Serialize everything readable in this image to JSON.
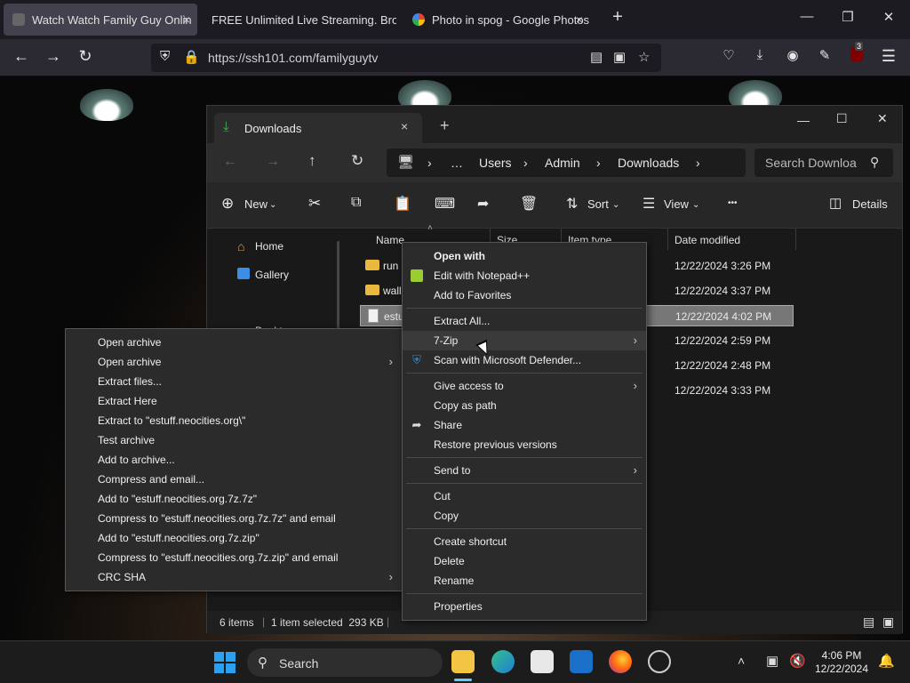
{
  "browser": {
    "tabs": [
      {
        "title": "Watch Watch Family Guy Onlin",
        "active": true
      },
      {
        "title": "FREE Unlimited Live Streaming. Bro",
        "active": false
      },
      {
        "title": "Photo in spog - Google Photos",
        "active": false
      }
    ],
    "url": "https://ssh101.com/familyguytv",
    "extension_badge": "3",
    "new_tab": "+",
    "close_glyph": "×"
  },
  "explorer": {
    "tab_title": "Downloads",
    "breadcrumb": [
      "Users",
      "Admin",
      "Downloads"
    ],
    "ellipsis": "…",
    "search_placeholder": "Search Downloa",
    "commands": {
      "new": "New",
      "sort": "Sort",
      "view": "View",
      "more": "•••",
      "details": "Details"
    },
    "nav_items": [
      "Home",
      "Gallery",
      "Deskt"
    ],
    "columns": {
      "name": "Name",
      "size": "Size",
      "type": "Item type",
      "date": "Date modified"
    },
    "files": [
      {
        "name": "run",
        "kind": "folder",
        "date": "12/22/2024 3:26 PM"
      },
      {
        "name": "wall",
        "kind": "folder",
        "date": "12/22/2024 3:37 PM"
      },
      {
        "name": "estu",
        "kind": "file",
        "date": "12/22/2024 4:02 PM",
        "selected": true
      },
      {
        "name": "",
        "kind": "file",
        "date": "12/22/2024 2:59 PM"
      },
      {
        "name": "",
        "kind": "file",
        "date": "12/22/2024 2:48 PM"
      },
      {
        "name": "",
        "kind": "file",
        "date": "12/22/2024 3:33 PM"
      }
    ],
    "status": {
      "items": "6 items",
      "selected": "1 item selected  293 KB"
    }
  },
  "context_menu": {
    "items": [
      {
        "label": "Open with",
        "bold": true
      },
      {
        "label": "Edit with Notepad++",
        "icon": "notepadpp-icon"
      },
      {
        "label": "Add to Favorites"
      },
      {
        "sep": true
      },
      {
        "label": "Extract All..."
      },
      {
        "label": "7-Zip",
        "submenu": true,
        "highlight": true
      },
      {
        "label": "Scan with Microsoft Defender...",
        "icon": "defender-shield-icon"
      },
      {
        "sep": true
      },
      {
        "label": "Give access to",
        "submenu": true
      },
      {
        "label": "Copy as path"
      },
      {
        "label": "Share",
        "icon": "share-icon"
      },
      {
        "label": "Restore previous versions"
      },
      {
        "sep": true
      },
      {
        "label": "Send to",
        "submenu": true
      },
      {
        "sep": true
      },
      {
        "label": "Cut"
      },
      {
        "label": "Copy"
      },
      {
        "sep": true
      },
      {
        "label": "Create shortcut"
      },
      {
        "label": "Delete"
      },
      {
        "label": "Rename"
      },
      {
        "sep": true
      },
      {
        "label": "Properties"
      }
    ],
    "submenu_arrow": "›"
  },
  "zip_menu": {
    "items": [
      {
        "label": "Open archive"
      },
      {
        "label": "Open archive",
        "submenu": true
      },
      {
        "label": "Extract files..."
      },
      {
        "label": "Extract Here"
      },
      {
        "label": "Extract to \"estuff.neocities.org\\\""
      },
      {
        "label": "Test archive"
      },
      {
        "label": "Add to archive..."
      },
      {
        "label": "Compress and email..."
      },
      {
        "label": "Add to \"estuff.neocities.org.7z.7z\""
      },
      {
        "label": "Compress to \"estuff.neocities.org.7z.7z\" and email"
      },
      {
        "label": "Add to \"estuff.neocities.org.7z.zip\""
      },
      {
        "label": "Compress to \"estuff.neocities.org.7z.zip\" and email"
      },
      {
        "label": "CRC SHA",
        "submenu": true
      }
    ]
  },
  "taskbar": {
    "search_label": "Search",
    "time": "4:06 PM",
    "date": "12/22/2024"
  },
  "colors": {
    "accent": "#0078d4",
    "folder": "#e8b93e",
    "selection": "#777777"
  }
}
